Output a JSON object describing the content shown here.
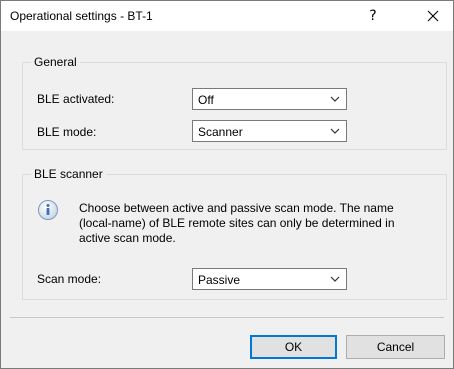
{
  "window": {
    "title": "Operational settings - BT-1",
    "help_label": "?"
  },
  "general": {
    "legend": "General",
    "ble_activated_label": "BLE activated:",
    "ble_activated_value": "Off",
    "ble_mode_label": "BLE mode:",
    "ble_mode_value": "Scanner"
  },
  "scanner": {
    "legend": "BLE scanner",
    "info_text": "Choose between active and passive scan mode. The name (local-name) of BLE remote sites can only be determined in active scan mode.",
    "scan_mode_label": "Scan mode:",
    "scan_mode_value": "Passive"
  },
  "buttons": {
    "ok_label": "OK",
    "cancel_label": "Cancel"
  },
  "colors": {
    "accent": "#0078d7",
    "info_icon": "#3b6fb6"
  }
}
